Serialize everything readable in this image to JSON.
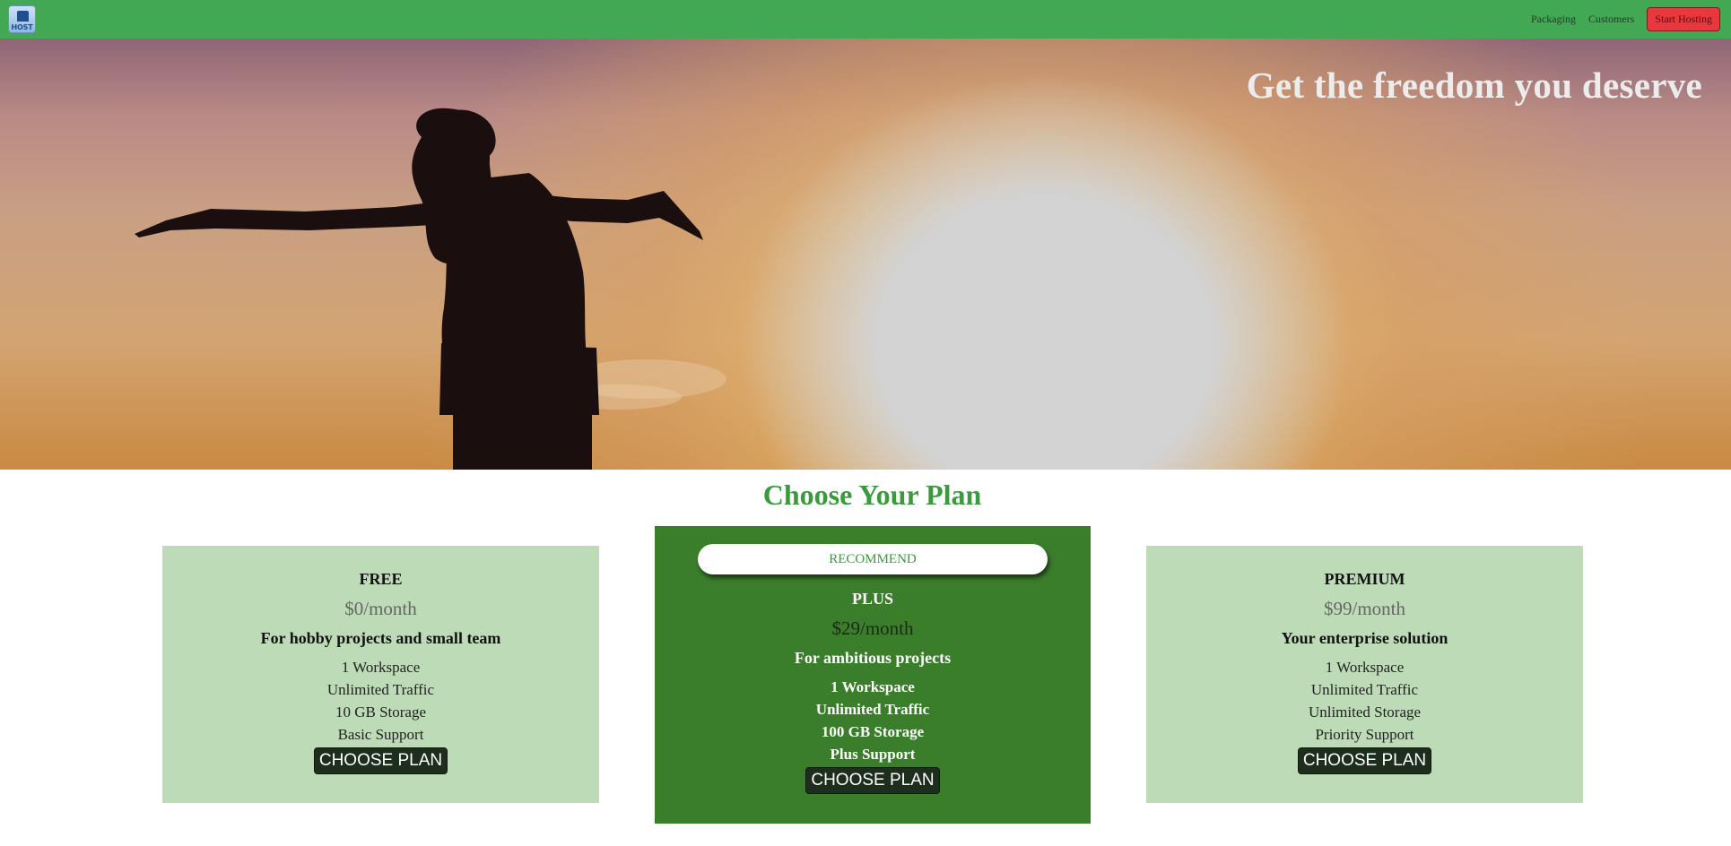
{
  "header": {
    "logo_text": "HOST",
    "nav": [
      {
        "label": "Packaging"
      },
      {
        "label": "Customers"
      }
    ],
    "cta_label": "Start Hosting"
  },
  "hero": {
    "title": "Get the freedom you deserve"
  },
  "plans": {
    "title": "Choose Your Plan",
    "free": {
      "name": "FREE",
      "price": "$0/month",
      "description": "For hobby projects and small team",
      "features": [
        "1 Workspace",
        "Unlimited Traffic",
        "10 GB Storage",
        "Basic Support"
      ],
      "button": "CHOOSE PLAN"
    },
    "plus": {
      "badge": "RECOMMEND",
      "name": "PLUS",
      "price": "$29/month",
      "description": "For ambitious projects",
      "features": [
        "1 Workspace",
        "Unlimited Traffic",
        "100 GB Storage",
        "Plus Support"
      ],
      "button": "CHOOSE PLAN"
    },
    "premium": {
      "name": "PREMIUM",
      "price": "$99/month",
      "description": "Your enterprise solution",
      "features": [
        "1 Workspace",
        "Unlimited Traffic",
        "Unlimited Storage",
        "Priority Support"
      ],
      "button": "CHOOSE PLAN"
    }
  },
  "colors": {
    "header_bg": "#43a853",
    "cta_bg": "#e8383d",
    "card_bg": "#bddbb6",
    "featured_card_bg": "#3a7d2b",
    "accent_text": "#3b9a3d",
    "button_bg": "#1d2f1c"
  }
}
